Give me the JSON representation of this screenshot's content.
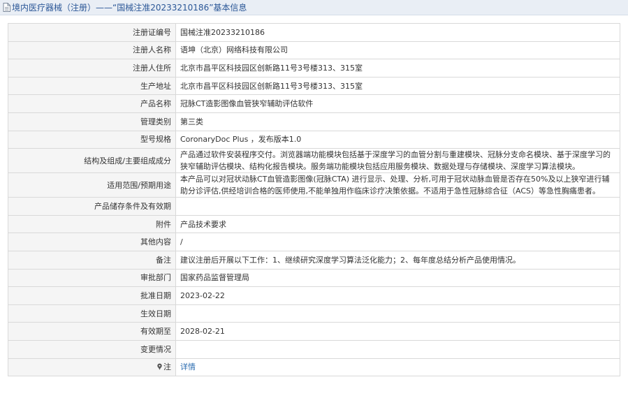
{
  "header": {
    "title": "境内医疗器械（注册）——“国械注准20233210186”基本信息",
    "icon": "document-icon"
  },
  "rows": [
    {
      "label": "注册证编号",
      "value": "国械注准20233210186"
    },
    {
      "label": "注册人名称",
      "value": "语坤（北京）网络科技有限公司"
    },
    {
      "label": "注册人住所",
      "value": "北京市昌平区科技园区创新路11号3号楼313、315室"
    },
    {
      "label": "生产地址",
      "value": "北京市昌平区科技园区创新路11号3号楼313、315室"
    },
    {
      "label": "产品名称",
      "value": "冠脉CT造影图像血管狭窄辅助评估软件"
    },
    {
      "label": "管理类别",
      "value": "第三类"
    },
    {
      "label": "型号规格",
      "value": "CoronaryDoc Plus ，发布版本1.0"
    },
    {
      "label": "结构及组成/主要组成成分",
      "value": "产品通过软件安装程序交付。浏览器端功能模块包括基于深度学习的血管分割与重建模块、冠脉分支命名模块、基于深度学习的狭窄辅助评估模块、结构化报告模块。服务端功能模块包括应用服务模块、数据处理与存储模块、深度学习算法模块。"
    },
    {
      "label": "适用范围/预期用途",
      "value": "本产品可以对冠状动脉CT血管造影图像(冠脉CTA) 进行显示、处理、分析,可用于冠状动脉血管是否存在50%及以上狭窄进行辅助分诊评估,供经培训合格的医师使用,不能单独用作临床诊疗决策依据。不适用于急性冠脉综合征（ACS）等急性胸痛患者。"
    },
    {
      "label": "产品储存条件及有效期",
      "value": ""
    },
    {
      "label": "附件",
      "value": "产品技术要求"
    },
    {
      "label": "其他内容",
      "value": "/"
    },
    {
      "label": "备注",
      "value": "建议注册后开展以下工作：1、继续研究深度学习算法泛化能力；2、每年度总结分析产品使用情况。"
    },
    {
      "label": "审批部门",
      "value": "国家药品监督管理局"
    },
    {
      "label": "批准日期",
      "value": "2023-02-22"
    },
    {
      "label": "生效日期",
      "value": ""
    },
    {
      "label": "有效期至",
      "value": "2028-02-21"
    },
    {
      "label": "变更情况",
      "value": ""
    }
  ],
  "note_row": {
    "label": "注",
    "icon": "pin-icon",
    "link_text": "详情"
  },
  "colors": {
    "title": "#2b5797",
    "header_bg": "#e9eef5",
    "label_bg": "#f5f5f5",
    "border": "#d9d9d9",
    "link": "#2b6cb0"
  }
}
